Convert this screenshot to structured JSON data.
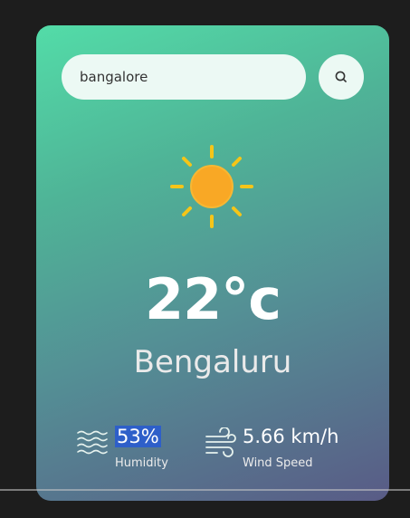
{
  "search": {
    "value": "bangalore",
    "placeholder": ""
  },
  "icons": {
    "search_button": "search-icon",
    "weather": "sun-icon",
    "humidity": "humidity-waves-icon",
    "wind": "wind-icon"
  },
  "weather": {
    "temperature": "22°c",
    "city": "Bengaluru"
  },
  "details": {
    "humidity": {
      "value": "53%",
      "label": "Humidity"
    },
    "wind": {
      "value": "5.66 km/h",
      "label": "Wind Speed"
    }
  },
  "colors": {
    "sun_rays": "#f5c518",
    "sun_core": "#f9a825",
    "selection_highlight": "#2e5fc9"
  }
}
